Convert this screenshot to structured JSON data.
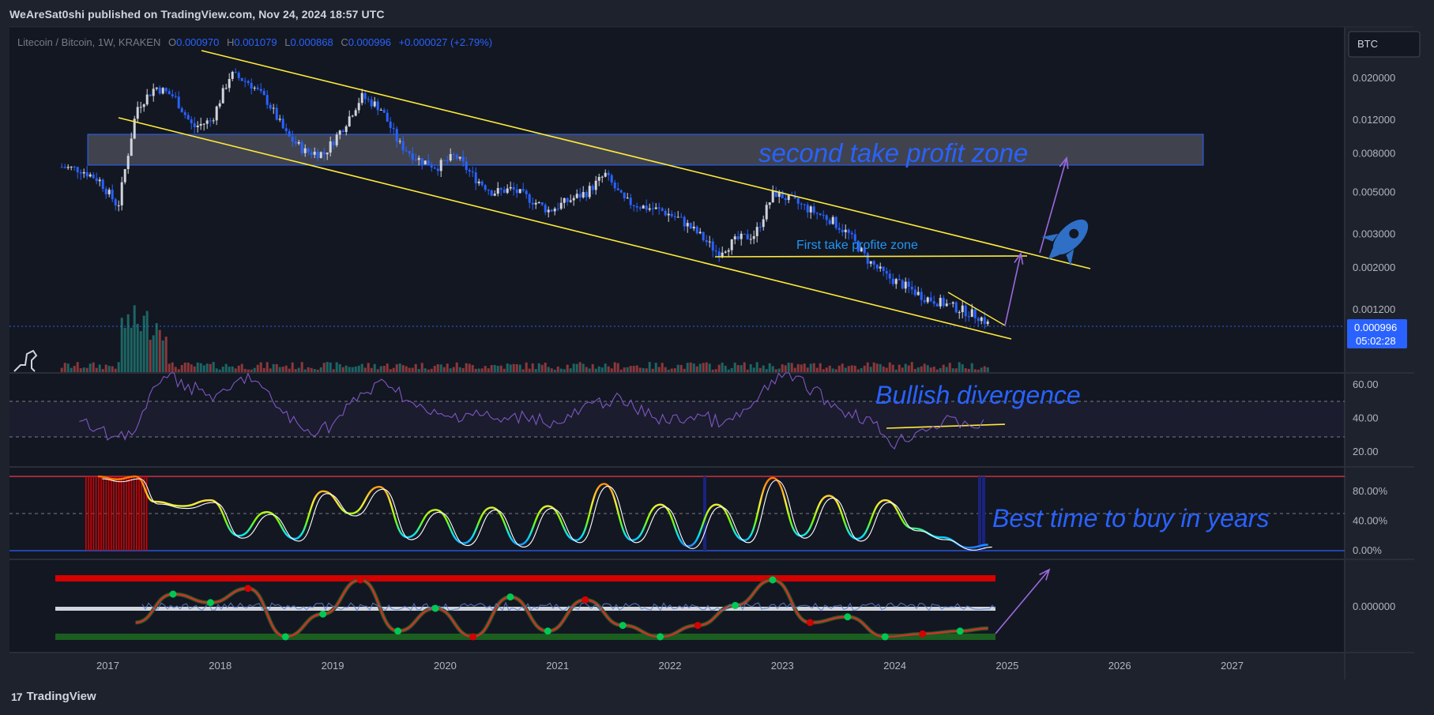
{
  "header": {
    "published": "WeAreSat0shi published on TradingView.com, Nov 24, 2024 18:57 UTC"
  },
  "footer": {
    "brand": "TradingView",
    "logo_glyph": "17"
  },
  "colors": {
    "bg": "#131722",
    "frame": "#1e222d",
    "grid": "#2a2e39",
    "price": "#d1d4dc",
    "channel": "#ffeb3b",
    "zone": "#787b86",
    "annotation": "#2962ff",
    "arrow": "#9c6ade",
    "rsi": "#7e57c2",
    "volume_up": "#26a69a",
    "volume_down": "#ef5350",
    "tag": "#2962ff"
  },
  "symbol": {
    "name": "Litecoin / Bitcoin, 1W, KRAKEN",
    "o_label": "O",
    "o": "0.000970",
    "h_label": "H",
    "h": "0.001079",
    "l_label": "L",
    "l": "0.000868",
    "c_label": "C",
    "c": "0.000996",
    "change": "+0.000027 (+2.79%)"
  },
  "currency": "BTC",
  "last_price": {
    "value": "0.000996",
    "countdown": "05:02:28"
  },
  "annotations": {
    "second_tp": "second take profit zone",
    "first_tp": "First take profite zone",
    "bullish": "Bullish divergence",
    "best_time": "Best  time to buy in years",
    "rocket": "rocket-icon"
  },
  "chart_data": [
    {
      "type": "candlestick",
      "title": "",
      "scale": "log",
      "y_ticks": [
        "0.020000",
        "0.012000",
        "0.008000",
        "0.005000",
        "0.003000",
        "0.002000",
        "0.001200"
      ],
      "x_ticks": [
        "2017",
        "2018",
        "2019",
        "2020",
        "2021",
        "2022",
        "2023",
        "2024",
        "2025",
        "2026",
        "2027"
      ],
      "x": [
        "2016-08",
        "2016-10",
        "2016-12",
        "2017-02",
        "2017-04",
        "2017-06",
        "2017-08",
        "2017-10",
        "2017-12",
        "2018-02",
        "2018-04",
        "2018-06",
        "2018-08",
        "2018-10",
        "2018-12",
        "2019-02",
        "2019-04",
        "2019-06",
        "2019-08",
        "2019-10",
        "2019-12",
        "2020-02",
        "2020-04",
        "2020-06",
        "2020-08",
        "2020-10",
        "2020-12",
        "2021-02",
        "2021-04",
        "2021-06",
        "2021-08",
        "2021-10",
        "2021-12",
        "2022-02",
        "2022-04",
        "2022-06",
        "2022-08",
        "2022-10",
        "2022-12",
        "2023-02",
        "2023-04",
        "2023-06",
        "2023-08",
        "2023-10",
        "2023-12",
        "2024-02",
        "2024-04",
        "2024-06",
        "2024-08",
        "2024-10",
        "2024-11"
      ],
      "close": [
        0.0068,
        0.0066,
        0.0058,
        0.0042,
        0.014,
        0.018,
        0.016,
        0.011,
        0.012,
        0.021,
        0.019,
        0.015,
        0.01,
        0.0082,
        0.008,
        0.011,
        0.016,
        0.014,
        0.009,
        0.0075,
        0.0068,
        0.0078,
        0.006,
        0.005,
        0.0052,
        0.0046,
        0.004,
        0.0045,
        0.005,
        0.0062,
        0.0045,
        0.0042,
        0.004,
        0.0036,
        0.003,
        0.0024,
        0.0028,
        0.003,
        0.005,
        0.0045,
        0.004,
        0.0036,
        0.003,
        0.0022,
        0.0018,
        0.0016,
        0.0014,
        0.0013,
        0.0012,
        0.0011,
        0.000996
      ]
    },
    {
      "type": "line",
      "title": "",
      "y_ticks": [
        "60.00",
        "40.00",
        "20.00"
      ],
      "x": [
        "2016-10",
        "2017-01",
        "2017-04",
        "2017-07",
        "2017-10",
        "2018-01",
        "2018-04",
        "2018-07",
        "2018-10",
        "2019-01",
        "2019-04",
        "2019-07",
        "2019-10",
        "2020-01",
        "2020-04",
        "2020-07",
        "2020-10",
        "2021-01",
        "2021-04",
        "2021-07",
        "2021-10",
        "2022-01",
        "2022-04",
        "2022-07",
        "2022-10",
        "2023-01",
        "2023-04",
        "2023-07",
        "2023-10",
        "2024-01",
        "2024-04",
        "2024-07",
        "2024-11"
      ],
      "values": [
        38,
        30,
        32,
        68,
        58,
        52,
        66,
        48,
        32,
        36,
        54,
        62,
        46,
        40,
        44,
        38,
        42,
        36,
        46,
        52,
        44,
        38,
        42,
        36,
        48,
        68,
        58,
        46,
        40,
        25,
        34,
        38,
        36
      ]
    },
    {
      "type": "line",
      "title": "",
      "y_ticks": [
        "80.00%",
        "40.00%",
        "0.00%"
      ],
      "x": [
        "2016-12",
        "2017-02",
        "2017-04",
        "2017-06",
        "2017-09",
        "2017-12",
        "2018-03",
        "2018-06",
        "2018-09",
        "2018-12",
        "2019-03",
        "2019-06",
        "2019-09",
        "2019-12",
        "2020-03",
        "2020-06",
        "2020-09",
        "2020-12",
        "2021-03",
        "2021-06",
        "2021-09",
        "2021-12",
        "2022-03",
        "2022-06",
        "2022-09",
        "2022-12",
        "2023-03",
        "2023-06",
        "2023-09",
        "2023-12",
        "2024-03",
        "2024-06",
        "2024-09",
        "2024-11"
      ],
      "values": [
        100,
        96,
        100,
        66,
        60,
        68,
        20,
        52,
        16,
        80,
        50,
        86,
        18,
        55,
        10,
        58,
        8,
        60,
        14,
        90,
        14,
        62,
        6,
        62,
        14,
        98,
        20,
        74,
        16,
        68,
        30,
        18,
        4,
        8
      ]
    },
    {
      "type": "line",
      "title": "",
      "y_ticks": [
        "0.000000"
      ],
      "x": [
        "2017-04",
        "2017-08",
        "2017-12",
        "2018-04",
        "2018-08",
        "2018-12",
        "2019-04",
        "2019-08",
        "2019-12",
        "2020-04",
        "2020-08",
        "2020-12",
        "2021-04",
        "2021-08",
        "2021-12",
        "2022-04",
        "2022-08",
        "2022-12",
        "2023-04",
        "2023-08",
        "2023-12",
        "2024-04",
        "2024-08",
        "2024-11"
      ],
      "values": [
        -0.5,
        0.5,
        0.2,
        0.7,
        -1.0,
        -0.2,
        1.0,
        -0.8,
        0.0,
        -1.0,
        0.4,
        -0.8,
        0.3,
        -0.6,
        -1.0,
        -0.6,
        0.1,
        1.0,
        -0.5,
        -0.3,
        -1.0,
        -0.9,
        -0.8,
        -0.7
      ]
    }
  ]
}
